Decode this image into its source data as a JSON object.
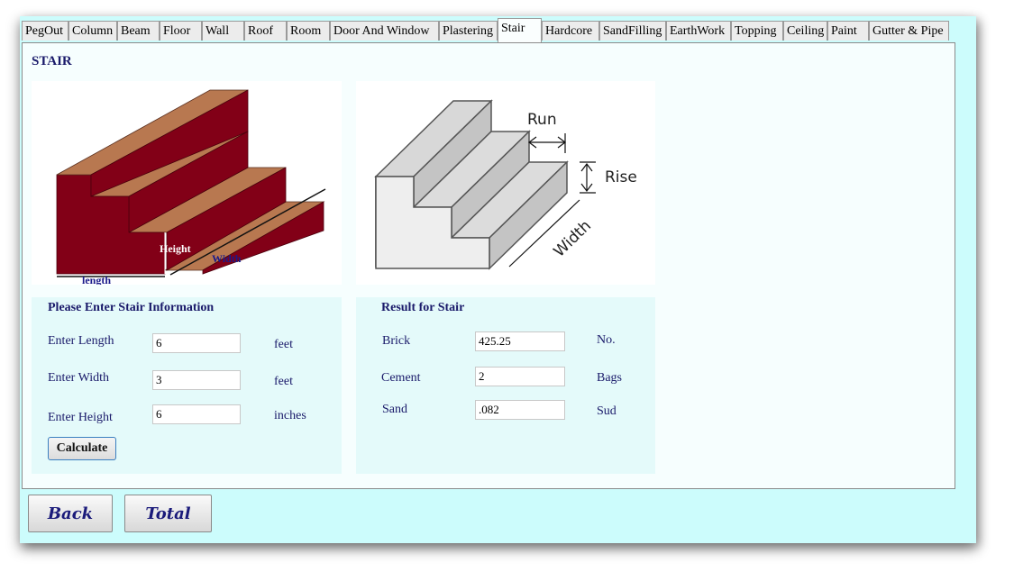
{
  "tabs": [
    {
      "label": "PegOut",
      "active": false
    },
    {
      "label": "Column",
      "active": false
    },
    {
      "label": "Beam",
      "active": false
    },
    {
      "label": "Floor",
      "active": false
    },
    {
      "label": "Wall",
      "active": false
    },
    {
      "label": "Roof",
      "active": false
    },
    {
      "label": "Room",
      "active": false
    },
    {
      "label": "Door And Window",
      "active": false
    },
    {
      "label": "Plastering",
      "active": false
    },
    {
      "label": "Stair",
      "active": true
    },
    {
      "label": "Hardcore",
      "active": false
    },
    {
      "label": "SandFilling",
      "active": false
    },
    {
      "label": "EarthWork",
      "active": false
    },
    {
      "label": "Topping",
      "active": false
    },
    {
      "label": "Ceiling",
      "active": false
    },
    {
      "label": "Paint",
      "active": false
    },
    {
      "label": "Gutter & Pipe",
      "active": false
    }
  ],
  "page_title": "STAIR",
  "image1": {
    "height_label": "Height",
    "width_label": "Width",
    "length_label": "length"
  },
  "image2": {
    "run_label": "Run",
    "rise_label": "Rise",
    "width_label": "Width"
  },
  "input_section": {
    "title": "Please Enter Stair Information",
    "length": {
      "label": "Enter Length",
      "value": "6",
      "unit": "feet"
    },
    "width": {
      "label": "Enter Width",
      "value": "3",
      "unit": "feet"
    },
    "height": {
      "label": "Enter Height",
      "value": "6",
      "unit": "inches"
    },
    "calculate_label": "Calculate"
  },
  "result_section": {
    "title": "Result for Stair",
    "brick": {
      "label": "Brick",
      "value": "425.25",
      "unit": "No."
    },
    "cement": {
      "label": "Cement",
      "value": "2",
      "unit": "Bags"
    },
    "sand": {
      "label": "Sand",
      "value": ".082",
      "unit": "Sud"
    }
  },
  "footer": {
    "back_label": "Back",
    "total_label": "Total"
  },
  "colors": {
    "background": "#ccfcfc",
    "panel": "#f6fefe",
    "label_text": "#1a1a6a",
    "stair_red": "#820017",
    "stair_tread": "#b87850"
  }
}
